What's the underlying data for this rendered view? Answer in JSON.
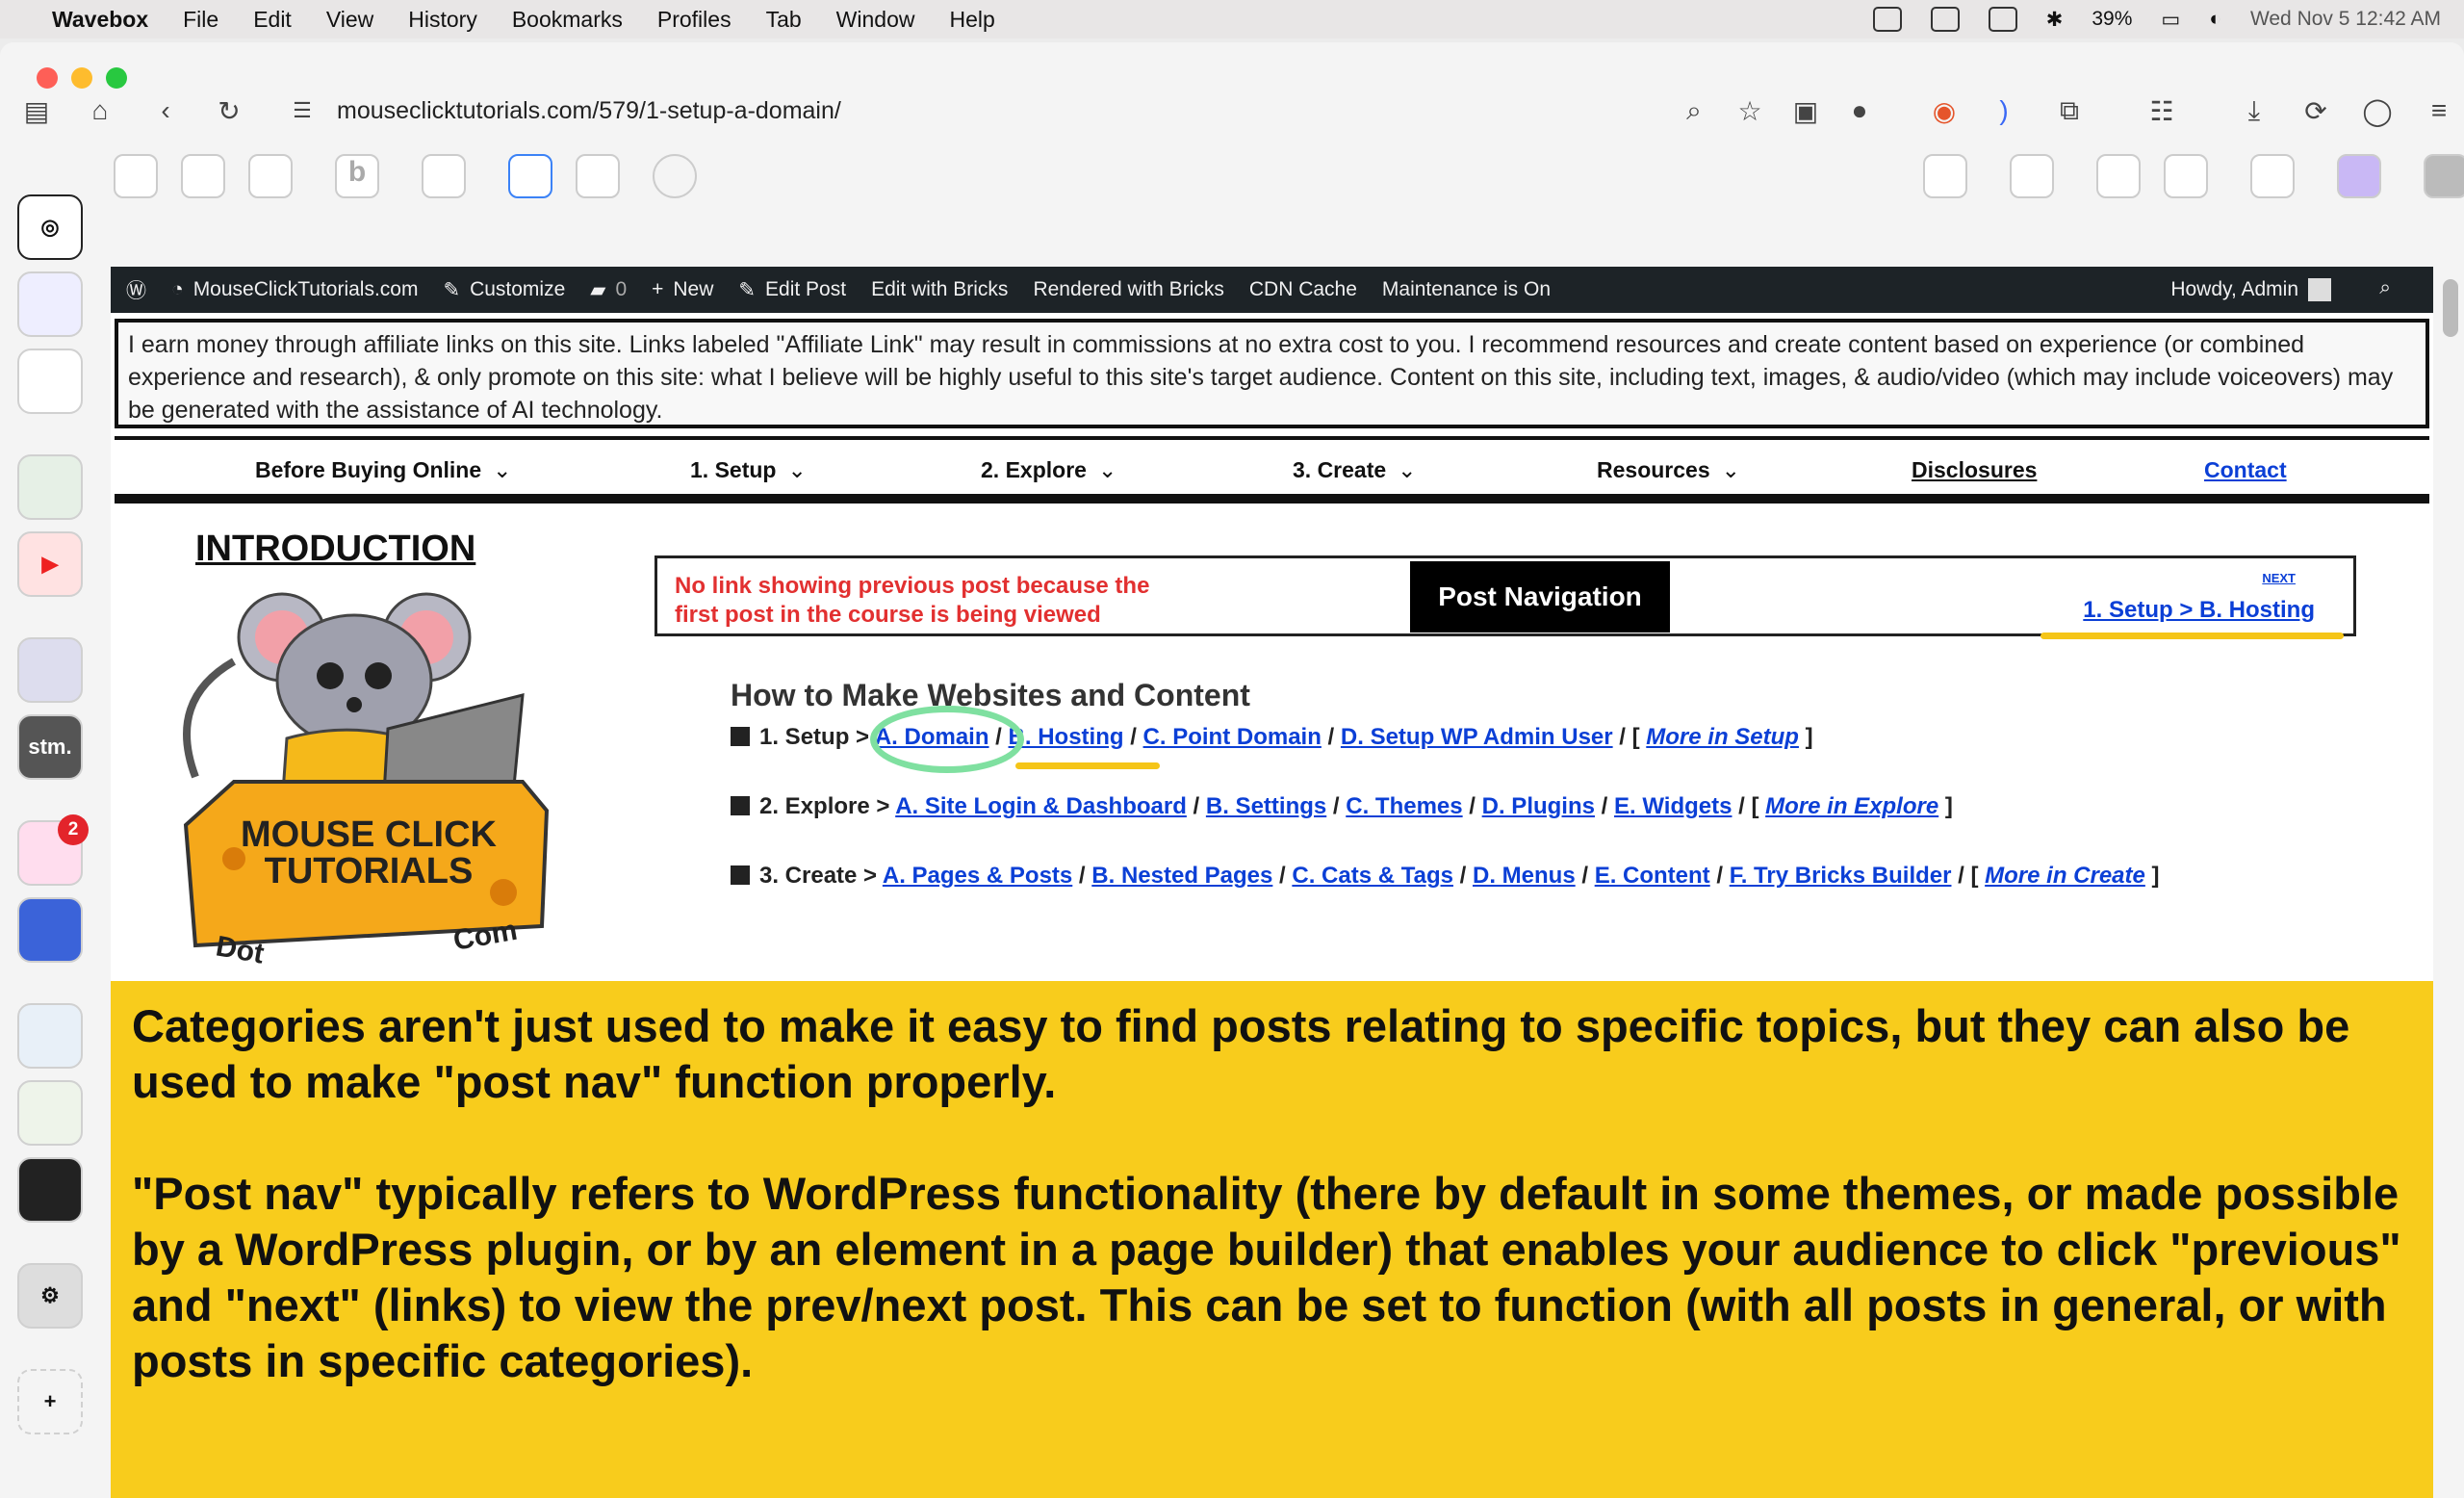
{
  "menubar": {
    "app_name": "Wavebox",
    "items": [
      "File",
      "Edit",
      "View",
      "History",
      "Bookmarks",
      "Profiles",
      "Tab",
      "Window",
      "Help"
    ],
    "battery": "39%",
    "datetime": "Wed Nov 5  12:42 AM"
  },
  "browser": {
    "url": "mouseclicktutorials.com/579/1-setup-a-domain/"
  },
  "wp_admin_bar": {
    "site": "MouseClickTutorials.com",
    "customize": "Customize",
    "comments": "0",
    "new": "New",
    "edit_post": "Edit Post",
    "edit_bricks": "Edit with Bricks",
    "rendered": "Rendered with Bricks",
    "cdn": "CDN Cache",
    "maintenance": "Maintenance is On",
    "howdy": "Howdy, Admin"
  },
  "disclaimer": "I earn money through affiliate links on this site. Links labeled \"Affiliate Link\" may result in commissions at no extra cost to you. I recommend resources and create content based on experience (or combined experience and research), & only promote on this site: what I believe will be highly useful to this site's target audience. Content on this site, including text, images, & audio/video (which may include voiceovers) may be generated with the assistance of AI technology.",
  "nav": {
    "before_buying": "Before Buying Online",
    "setup": "1. Setup",
    "explore": "2. Explore",
    "create": "3. Create",
    "resources": "Resources",
    "disclosures": "Disclosures",
    "contact": "Contact"
  },
  "intro_heading": "INTRODUCTION",
  "logo": {
    "line1": "MOUSE CLICK",
    "line2": "TUTORIALS",
    "left": "Dot",
    "right": "Com"
  },
  "post_nav": {
    "no_prev": "No link showing previous post because the first post in the course is being viewed",
    "title": "Post Navigation",
    "next_label": "NEXT",
    "next_link": "1. Setup > B. Hosting"
  },
  "course": {
    "heading": "How to Make Websites and Content",
    "setup": {
      "prefix": "1. Setup >",
      "links": [
        "A. Domain",
        "B. Hosting",
        "C. Point Domain",
        "D. Setup WP Admin User"
      ],
      "more": "More in Setup"
    },
    "explore": {
      "prefix": "2. Explore >",
      "links": [
        "A. Site Login & Dashboard",
        "B. Settings",
        "C. Themes",
        "D. Plugins",
        "E. Widgets"
      ],
      "more": "More in Explore"
    },
    "create": {
      "prefix": "3. Create >",
      "links": [
        "A. Pages & Posts",
        "B. Nested Pages",
        "C. Cats & Tags",
        "D. Menus",
        "E. Content",
        "F. Try Bricks Builder"
      ],
      "more": "More in Create"
    }
  },
  "callout": {
    "p1": "Categories aren't just used to make it easy to find posts relating to specific topics, but they can also be used to make \"post nav\" function properly.",
    "p2": "\"Post nav\" typically refers to WordPress functionality (there by default in some themes, or made possible by a WordPress plugin, or by an element in a page builder) that enables your audience to click \"previous\" and \"next\" (links) to view the prev/next post. This can be set to function (with all posts in general, or with posts in specific categories)."
  },
  "sidebar_badge": "2",
  "sidebar_labels": {
    "b": "b",
    "stm": "stm."
  },
  "colors": {
    "accent_yellow": "#f8cc1c",
    "link_blue": "#0b3fd6",
    "warning_red": "#e23030",
    "wp_bar": "#1d2327"
  }
}
